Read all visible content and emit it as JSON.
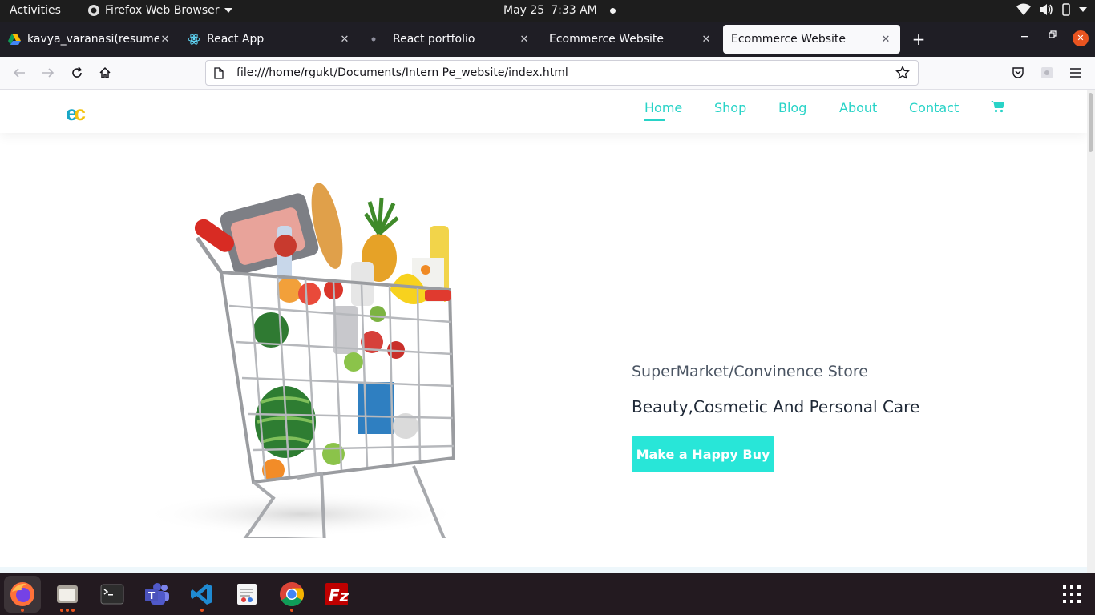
{
  "topbar": {
    "activities": "Activities",
    "app_name": "Firefox Web Browser",
    "date": "May 25",
    "time": "7:33 AM"
  },
  "tabs": [
    {
      "title": "kavya_varanasi(resume) (",
      "favicon": "google-drive-icon"
    },
    {
      "title": "React App",
      "favicon": "react-icon"
    },
    {
      "title": "React portfolio",
      "favicon": "dot-icon"
    },
    {
      "title": "Ecommerce Website",
      "favicon": "none"
    },
    {
      "title": "Ecommerce Website",
      "favicon": "none",
      "active": true
    }
  ],
  "urlbar": {
    "url": "file:///home/rgukt/Documents/Intern Pe_website/index.html"
  },
  "site": {
    "logo": {
      "e": "e",
      "c": "c"
    },
    "nav": {
      "home": "Home",
      "shop": "Shop",
      "blog": "Blog",
      "about": "About",
      "contact": "Contact"
    },
    "hero": {
      "subtitle": "SuperMarket/Convinence Store",
      "title": "Beauty,Cosmetic And Personal Care",
      "button": "Make a Happy Buy"
    }
  },
  "colors": {
    "accent": "#28d3c7",
    "button": "#28e6d8",
    "logo_e": "#19a7c6",
    "logo_c": "#f4c20d",
    "ubuntu_orange": "#e95420"
  },
  "dock": [
    {
      "name": "firefox-icon",
      "active": true,
      "dots": 1
    },
    {
      "name": "files-icon",
      "dots": 3
    },
    {
      "name": "terminal-icon",
      "dots": 0
    },
    {
      "name": "teams-icon",
      "dots": 0
    },
    {
      "name": "vscode-icon",
      "dots": 1
    },
    {
      "name": "text-editor-icon",
      "dots": 0
    },
    {
      "name": "chrome-icon",
      "dots": 1
    },
    {
      "name": "filezilla-icon",
      "dots": 0
    }
  ]
}
